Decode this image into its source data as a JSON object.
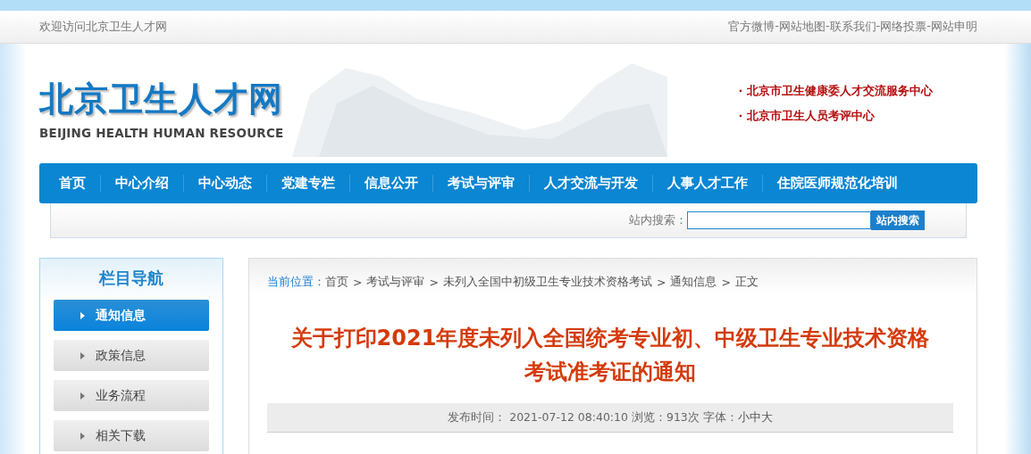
{
  "top_bar": {
    "welcome": "欢迎访问北京卫生人才网",
    "links": [
      "官方微博",
      "网站地图",
      "联系我们",
      "网络投票",
      "网站申明"
    ],
    "separator": "-"
  },
  "header": {
    "logo_title": "北京卫生人才网",
    "logo_subtitle": "BEIJING HEALTH HUMAN RESOURCE",
    "bullet": "·",
    "links": [
      "北京市卫生健康委人才交流服务中心",
      "北京市卫生人员考评中心"
    ]
  },
  "nav": [
    "首页",
    "中心介绍",
    "中心动态",
    "党建专栏",
    "信息公开",
    "考试与评审",
    "人才交流与开发",
    "人事人才工作",
    "住院医师规范化培训"
  ],
  "search": {
    "label": "站内搜索：",
    "button": "站内搜索"
  },
  "sidebar": {
    "title": "栏目导航",
    "items": [
      {
        "label": "通知信息",
        "selected": true
      },
      {
        "label": "政策信息",
        "selected": false
      },
      {
        "label": "业务流程",
        "selected": false
      },
      {
        "label": "相关下载",
        "selected": false
      }
    ]
  },
  "breadcrumb": {
    "label": "当前位置：",
    "separator": ">",
    "items": [
      "首页",
      "考试与评审",
      "未列入全国中初级卫生专业技术资格考试",
      "通知信息",
      "正文"
    ]
  },
  "article": {
    "title": "关于打印2021年度未列入全国统考专业初、中级卫生专业技术资格考试准考证的通知",
    "meta": "发布时间： 2021-07-12 08:40:10 浏览：913次 字体：",
    "font_sizes": [
      "小",
      "中",
      "大"
    ]
  }
}
